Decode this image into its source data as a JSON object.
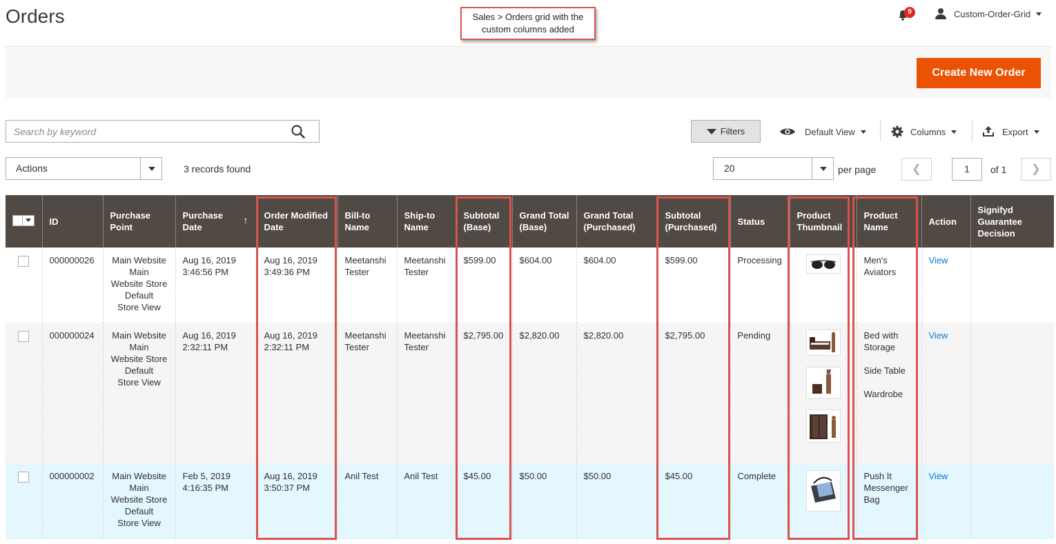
{
  "header": {
    "title": "Orders",
    "notifications_count": "9",
    "user": "Custom-Order-Grid"
  },
  "callout": "Sales > Orders grid with the custom columns added",
  "toolbar": {
    "create_label": "Create New Order",
    "search_placeholder": "Search by keyword",
    "filters_label": "Filters",
    "view_label": "Default View",
    "columns_label": "Columns",
    "export_label": "Export",
    "actions_label": "Actions",
    "records_found": "3 records found",
    "per_page_value": "20",
    "per_page_label": "per page",
    "page_value": "1",
    "page_of": "of 1"
  },
  "columns": [
    "ID",
    "Purchase Point",
    "Purchase Date",
    "Order Modified Date",
    "Bill-to Name",
    "Ship-to Name",
    "Subtotal (Base)",
    "Grand Total (Base)",
    "Grand Total (Purchased)",
    "Subtotal (Purchased)",
    "Status",
    "Product Thumbnail",
    "Product Name",
    "Action",
    "Signifyd Guarantee Decision"
  ],
  "rows": [
    {
      "id": "000000026",
      "purchase_point": [
        "Main Website",
        "Main",
        "Website Store",
        "Default",
        "Store View"
      ],
      "purchase_date": [
        "Aug 16, 2019",
        "3:46:56 PM"
      ],
      "modified_date": [
        "Aug 16, 2019",
        "3:49:36 PM"
      ],
      "bill_to": "Meetanshi Tester",
      "ship_to": "Meetanshi Tester",
      "subtotal_base": "$599.00",
      "grand_total_base": "$604.00",
      "grand_total_purchased": "$604.00",
      "subtotal_purchased": "$599.00",
      "status": "Processing",
      "products": [
        "Men's Aviators"
      ],
      "action": "View"
    },
    {
      "id": "000000024",
      "purchase_point": [
        "Main Website",
        "Main",
        "Website Store",
        "Default",
        "Store View"
      ],
      "purchase_date": [
        "Aug 16, 2019",
        "2:32:11 PM"
      ],
      "modified_date": [
        "Aug 16, 2019",
        "2:32:11 PM"
      ],
      "bill_to": "Meetanshi Tester",
      "ship_to": "Meetanshi Tester",
      "subtotal_base": "$2,795.00",
      "grand_total_base": "$2,820.00",
      "grand_total_purchased": "$2,820.00",
      "subtotal_purchased": "$2,795.00",
      "status": "Pending",
      "products": [
        "Bed with Storage",
        "Side Table",
        "Wardrobe"
      ],
      "action": "View"
    },
    {
      "id": "000000002",
      "purchase_point": [
        "Main Website",
        "Main",
        "Website Store",
        "Default",
        "Store View"
      ],
      "purchase_date": [
        "Feb 5, 2019",
        "4:16:35 PM"
      ],
      "modified_date": [
        "Aug 16, 2019",
        "3:50:37 PM"
      ],
      "bill_to": "Anil Test",
      "ship_to": "Anil Test",
      "subtotal_base": "$45.00",
      "grand_total_base": "$50.00",
      "grand_total_purchased": "$50.00",
      "subtotal_purchased": "$45.00",
      "status": "Complete",
      "products": [
        "Push It Messenger Bag"
      ],
      "action": "View"
    }
  ],
  "colors": {
    "accent": "#eb5202",
    "header_bg": "#514943",
    "highlight": "#d9534f",
    "link": "#007bdb"
  }
}
